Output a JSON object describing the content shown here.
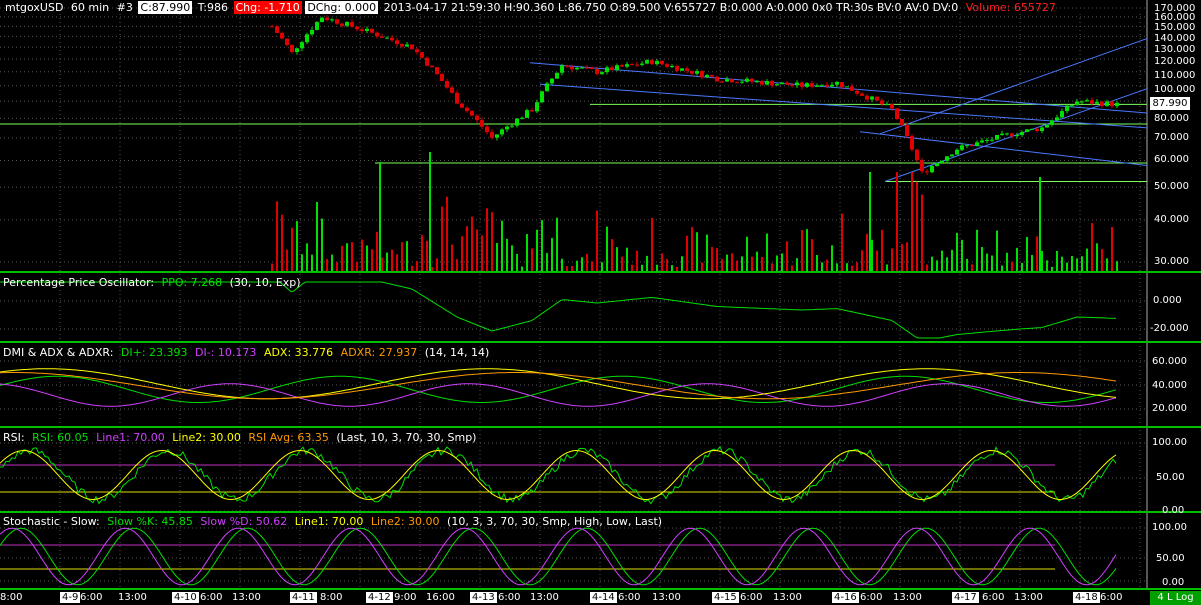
{
  "header": {
    "symbol": "mtgoxUSD",
    "interval": "60 min",
    "tag": "#3",
    "close": "C:87.990",
    "trades": "T:986",
    "change": "Chg: -1.710",
    "datetime_ohlc": "2013-04-17 21:59:30 H:90.360 L:86.750 O:89.500 V:655727 B:0.000 A:0.000 0x0 TR:30s BV:0 AV:0 DV:0",
    "dchg": "DChg: 0.000",
    "volume_label": "Volume:",
    "volume_value": "Volume: 655727"
  },
  "last_price_tag": "87.990",
  "scale_button": "4 L Log",
  "price_axis": [
    "170.000",
    "160.000",
    "150.000",
    "140.000",
    "130.000",
    "120.000",
    "110.000",
    "100.000",
    "90.000",
    "80.000",
    "70.000",
    "60.000",
    "50.000",
    "40.000",
    "30.000"
  ],
  "time_axis": [
    "8:00",
    "4-9",
    "6:00",
    "13:00",
    "4-10",
    "6:00",
    "13:00",
    "4-11",
    "8:00",
    "4-12",
    "9:00",
    "16:00",
    "4-13",
    "6:00",
    "13:00",
    "4-14",
    "6:00",
    "13:00",
    "4-15",
    "6:00",
    "13:00",
    "4-16",
    "6:00",
    "13:00",
    "4-17",
    "6:00",
    "13:00",
    "4-18",
    "6:00"
  ],
  "panes": {
    "ppo": {
      "title": "Percentage Price Oscillator:",
      "value": "PPO: 7.268",
      "params": "(30, 10, Exp)",
      "axis": [
        "0.000",
        "-20.000"
      ]
    },
    "dmi": {
      "title": "DMI & ADX & ADXR:",
      "di_plus": "DI+: 23.393",
      "di_minus": "DI-: 10.173",
      "adx": "ADX: 33.776",
      "adxr": "ADXR: 27.937",
      "params": "(14, 14, 14)",
      "axis": [
        "60.000",
        "40.000",
        "20.000"
      ]
    },
    "rsi": {
      "title": "RSI:",
      "rsi": "RSI: 60.05",
      "line1": "Line1: 70.00",
      "line2": "Line2: 30.00",
      "avg": "RSI Avg: 63.35",
      "params": "(Last, 10, 3, 70, 30, Smp)",
      "axis": [
        "100.00",
        "50.00",
        "0.00"
      ]
    },
    "stoch": {
      "title": "Stochastic - Slow:",
      "k": "Slow %K: 45.85",
      "d": "Slow %D: 50.62",
      "line1": "Line1: 70.00",
      "line2": "Line2: 30.00",
      "params": "(10, 3, 3, 70, 30, Smp, High, Low, Last)",
      "axis": [
        "100.00",
        "50.00",
        "0.00"
      ]
    }
  },
  "colors": {
    "up": "#00e000",
    "down": "#e00000",
    "grid": "#555555",
    "trend_blue": "#4a78ff",
    "level_green": "#7cff5a",
    "rsi_line": "#00e000",
    "rsi_avg": "#ffff00",
    "ref_magenta": "#c030c0",
    "ref_yellow": "#e0e000",
    "di_plus": "#00e000",
    "di_minus": "#d040ff",
    "adx": "#ffff00",
    "adxr": "#ff9900"
  },
  "chart_data": {
    "type": "candlestick",
    "symbol": "mtgoxUSD",
    "interval": "60 min",
    "y_scale": "log",
    "ylim": [
      30,
      170
    ],
    "x_dates": [
      "4-9",
      "4-10",
      "4-11",
      "4-12",
      "4-13",
      "4-14",
      "4-15",
      "4-16",
      "4-17",
      "4-18"
    ],
    "price_path": [
      {
        "t": "4-10 20:00",
        "close": 150
      },
      {
        "t": "4-11 0:00",
        "close": 125
      },
      {
        "t": "4-11 6:00",
        "close": 160
      },
      {
        "t": "4-11 12:00",
        "close": 150
      },
      {
        "t": "4-12 0:00",
        "close": 130
      },
      {
        "t": "4-12 9:00",
        "close": 90
      },
      {
        "t": "4-12 16:00",
        "close": 70
      },
      {
        "t": "4-13 0:00",
        "close": 85
      },
      {
        "t": "4-13 6:00",
        "close": 115
      },
      {
        "t": "4-13 13:00",
        "close": 110
      },
      {
        "t": "4-14 0:00",
        "close": 118
      },
      {
        "t": "4-14 13:00",
        "close": 105
      },
      {
        "t": "4-15 6:00",
        "close": 100
      },
      {
        "t": "4-15 13:00",
        "close": 102
      },
      {
        "t": "4-16 0:00",
        "close": 85
      },
      {
        "t": "4-16 6:00",
        "close": 55
      },
      {
        "t": "4-16 13:00",
        "close": 65
      },
      {
        "t": "4-17 0:00",
        "close": 72
      },
      {
        "t": "4-17 6:00",
        "close": 75
      },
      {
        "t": "4-17 13:00",
        "close": 90
      },
      {
        "t": "4-17 21:00",
        "close": 87.99
      }
    ],
    "horizontal_levels": [
      87.99,
      77,
      59,
      52
    ],
    "last_close": 87.99,
    "volume_last": 655727,
    "indicators": {
      "ppo": {
        "last": 7.268,
        "params": [
          30,
          10,
          "Exp"
        ]
      },
      "dmi": {
        "di_plus": 23.393,
        "di_minus": 10.173,
        "adx": 33.776,
        "adxr": 27.937
      },
      "rsi": {
        "rsi": 60.05,
        "line1": 70,
        "line2": 30,
        "avg": 63.35
      },
      "stochastic_slow": {
        "k": 45.85,
        "d": 50.62,
        "line1": 70,
        "line2": 30
      }
    }
  }
}
